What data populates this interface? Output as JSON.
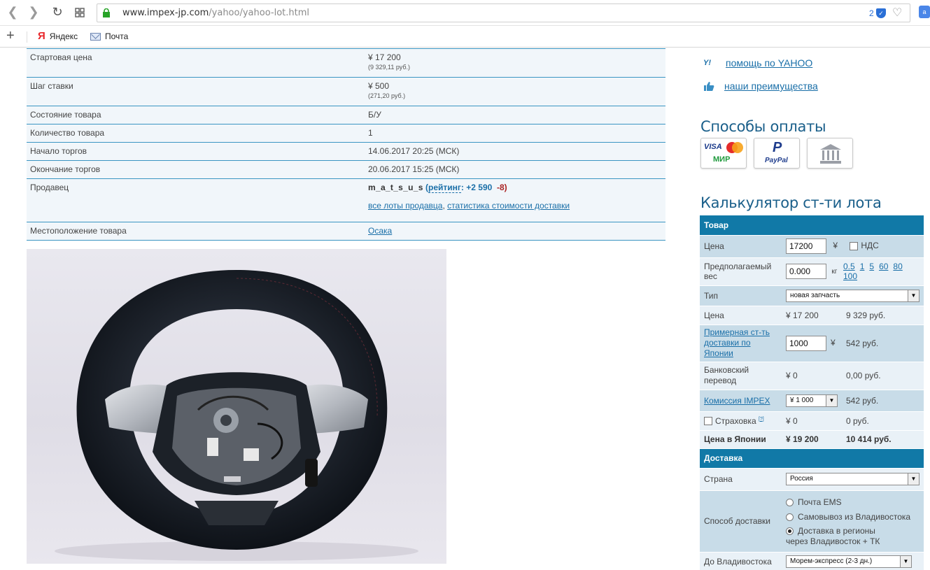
{
  "browser": {
    "url_host": "www.impex-jp.com",
    "url_path": "/yahoo/yahoo-lot.html",
    "badge_count": "2",
    "bookmarks": [
      {
        "label": "Яндекс",
        "icon": "yandex-icon"
      },
      {
        "label": "Почта",
        "icon": "mail-icon"
      }
    ]
  },
  "lot": {
    "rows": {
      "start_price": {
        "label": "Стартовая цена",
        "value": "¥ 17 200",
        "sub": "(9 329,11 руб.)"
      },
      "bid_step": {
        "label": "Шаг ставки",
        "value": "¥ 500",
        "sub": "(271,20 руб.)"
      },
      "condition": {
        "label": "Состояние товара",
        "value": "Б/У"
      },
      "quantity": {
        "label": "Количество товара",
        "value": "1"
      },
      "start": {
        "label": "Начало торгов",
        "value": "14.06.2017 20:25 (МСК)"
      },
      "end": {
        "label": "Окончание торгов",
        "value": "20.06.2017 15:25 (МСК)"
      },
      "seller": {
        "label": "Продавец",
        "name": "m_a_t_s_u_s",
        "open": "(",
        "rating_label": "рейтинг",
        "colon": ":",
        "rating_pos": "+2 590",
        "rating_neg": "-8",
        "close": ")",
        "all_lots": "все лоты продавца",
        "comma": ",",
        "shipping_stats": "статистика стоимости доставки"
      },
      "location": {
        "label": "Местоположение товара",
        "value": "Осака"
      }
    }
  },
  "sidebar": {
    "help_link": "помощь по YAHOO",
    "advantages_link": "наши преимущества",
    "payment_title": "Способы оплаты",
    "payment_methods": [
      "VISA",
      "MasterCard",
      "МИР",
      "PayPal",
      "BANK"
    ],
    "calc_title": "Калькулятор ст-ти лота"
  },
  "calc": {
    "section_goods": "Товар",
    "price_label": "Цена",
    "price_value": "17200",
    "yen": "¥",
    "vat_label": "НДС",
    "weight_label": "Предполагаемый вес",
    "weight_value": "0.000",
    "weight_unit": "кг",
    "weights": [
      "0.5",
      "1",
      "5",
      "60",
      "80",
      "100"
    ],
    "type_label": "Тип",
    "type_value": "новая запчасть",
    "price2_label": "Цена",
    "price2_yen": "¥ 17 200",
    "price2_rub": "9 329 руб.",
    "ship_jp_label": "Примерная ст-ть доставки по Японии",
    "ship_jp_value": "1000",
    "ship_jp_rub": "542 руб.",
    "bank_label": "Банковский перевод",
    "bank_yen": "¥ 0",
    "bank_rub": "0,00 руб.",
    "commission_label": "Комиссия IMPEX",
    "commission_value": "¥ 1 000",
    "commission_rub": "542 руб.",
    "insurance_label": "Страховка",
    "insurance_help": "[?]",
    "insurance_yen": "¥ 0",
    "insurance_rub": "0 руб.",
    "total_label": "Цена в Японии",
    "total_yen": "¥ 19 200",
    "total_rub": "10 414 руб.",
    "section_delivery": "Доставка",
    "country_label": "Страна",
    "country_value": "Россия",
    "method_label": "Способ доставки",
    "methods": [
      "Почта EMS",
      "Самовывоз из Владивостока",
      "Доставка в регионы",
      "через Владивосток + ТК"
    ],
    "vlad_label": "До Владивостока",
    "vlad_value": "Морем-экспресс (2-3 дн.)"
  },
  "colors": {
    "accent": "#1179a7",
    "link": "#1a6fa8",
    "table_border": "#3a95c2"
  }
}
